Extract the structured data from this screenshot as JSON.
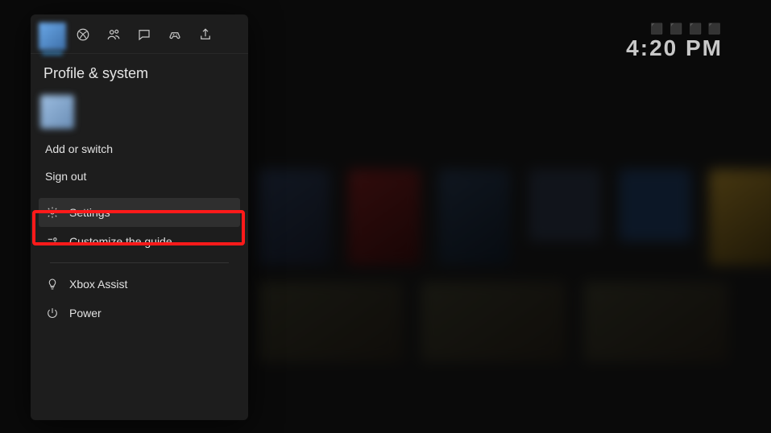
{
  "clock": {
    "status": "⬛ ⬛ ⬛ ⬛",
    "time": "4:20 PM"
  },
  "guide": {
    "title": "Profile & system",
    "tabs": {
      "profile": "Profile",
      "xbox": "Home",
      "people": "People",
      "chat": "Chat",
      "games": "My games & apps",
      "share": "Capture & share"
    },
    "menu": {
      "add_or_switch": "Add or switch",
      "sign_out": "Sign out",
      "settings": "Settings",
      "customize": "Customize the guide",
      "assist": "Xbox Assist",
      "power": "Power"
    }
  }
}
